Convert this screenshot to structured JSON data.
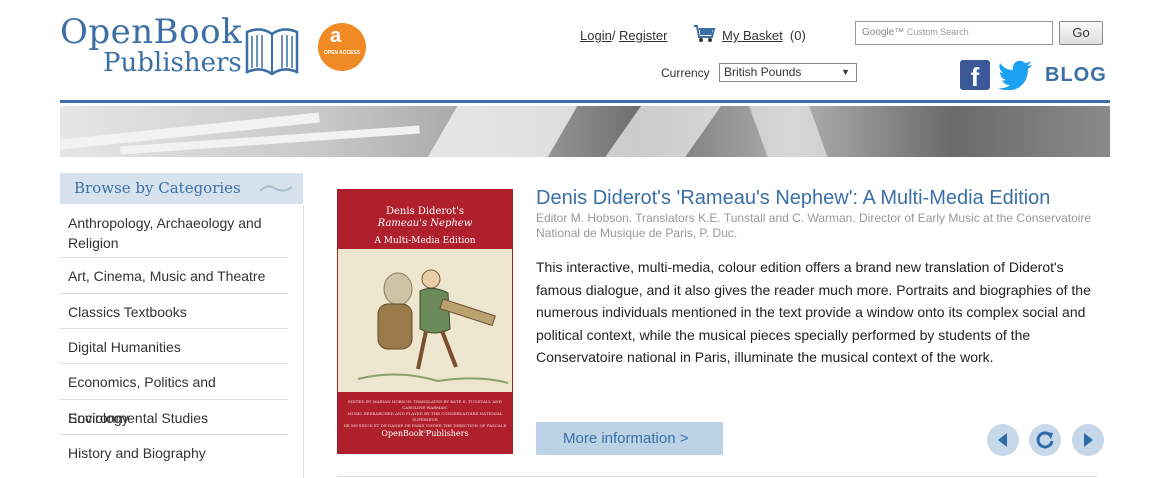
{
  "header": {
    "logo_line1": "OpenBook",
    "logo_line2": "Publishers",
    "oa_badge": "OPEN ACCESS",
    "login": "Login",
    "register": "Register",
    "basket_label": "My Basket",
    "basket_count": "(0)",
    "search_placeholder": "Custom Search",
    "go_button": "Go",
    "currency_label": "Currency",
    "currency_value": "British Pounds",
    "blog": "BLOG"
  },
  "sidebar": {
    "heading": "Browse by Categories",
    "items": [
      "Anthropology, Archaeology and Religion",
      "Art, Cinema, Music and Theatre",
      "Classics Textbooks",
      "Digital Humanities",
      "Economics, Politics and Sociology",
      "Environmental Studies",
      "History and Biography"
    ]
  },
  "feature": {
    "cover_title_1": "Denis Diderot's",
    "cover_title_2": "Rameau's Nephew",
    "cover_subtitle": "A Multi-Media Edition",
    "cover_publisher": "OpenBook Publishers",
    "title": "Denis Diderot's 'Rameau's Nephew': A Multi-Media Edition",
    "credits": "Editor M. Hobson. Translators K.E. Tunstall and C. Warman. Director of Early Music at the Conservatoire National de Musique de Paris, P. Duc.",
    "description": "This interactive, multi-media, colour edition offers a brand new translation of Diderot's famous dialogue, and it also gives the reader much more. Portraits and biographies of the numerous individuals mentioned in the text provide a window onto its complex social and political context, while the musical pieces specially performed by students of the Conservatoire national in Paris, illuminate the musical context of the work.",
    "more_button": "More information >"
  },
  "icons": {
    "basket": "basket-icon",
    "facebook": "facebook-icon",
    "twitter": "twitter-icon",
    "prev": "prev-icon",
    "refresh": "refresh-icon",
    "next": "next-icon"
  },
  "colors": {
    "brand_blue": "#3b6fa6",
    "cover_red": "#b0202c",
    "oa_orange": "#f08a24"
  }
}
